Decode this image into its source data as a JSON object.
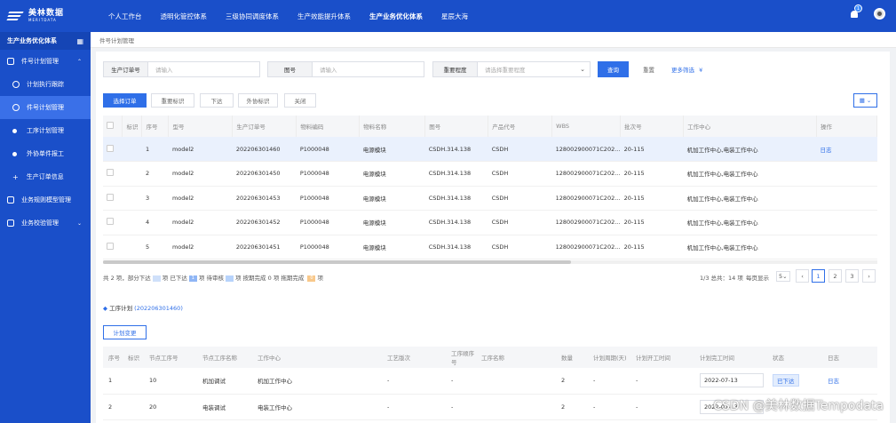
{
  "topbar": {
    "logo_cn": "美林数据",
    "logo_en": "MERITDATA",
    "nav": [
      "个人工作台",
      "透明化管控体系",
      "三级协同调度体系",
      "生产效能提升体系",
      "生产业务优化体系",
      "星辰大海"
    ],
    "badge": "1"
  },
  "sidebar": {
    "header": "生产业务优化体系",
    "items": [
      {
        "label": "件号计划管理"
      },
      {
        "label": "计划执行跟踪"
      },
      {
        "label": "件号计划管理"
      },
      {
        "label": "工序计划管理"
      },
      {
        "label": "外协单件报工"
      },
      {
        "label": "生产订单信息"
      },
      {
        "label": "业务规则模型管理"
      },
      {
        "label": "业务校验管理"
      }
    ]
  },
  "breadcrumb": "件号计划管理",
  "search": {
    "order_label": "生产订单号",
    "order_placeholder": "请输入",
    "drawing_label": "图号",
    "drawing_placeholder": "请输入",
    "priority_label": "重要程度",
    "priority_placeholder": "请选择重要程度",
    "query": "查询",
    "reset": "重置",
    "more": "更多筛选"
  },
  "toolbar": {
    "select_order": "选择订单",
    "important_mark": "重要标识",
    "issue": "下达",
    "outsource_mark": "外协标识",
    "close": "关闭"
  },
  "table": {
    "headers": [
      "标识",
      "序号",
      "型号",
      "生产订单号",
      "物料编码",
      "物料名称",
      "图号",
      "产品代号",
      "WBS",
      "批次号",
      "工作中心",
      "操作"
    ],
    "rows": [
      [
        "1",
        "model2",
        "202206301460",
        "P1000048",
        "电源模块",
        "CSDH.314.138",
        "CSDH",
        "128002900071C202...",
        "20-115",
        "机加工作中心,电装工作中心",
        "日志"
      ],
      [
        "2",
        "model2",
        "202206301450",
        "P1000048",
        "电源模块",
        "CSDH.314.138",
        "CSDH",
        "128002900071C202...",
        "20-115",
        "机加工作中心,电装工作中心",
        ""
      ],
      [
        "3",
        "model2",
        "202206301453",
        "P1000048",
        "电源模块",
        "CSDH.314.138",
        "CSDH",
        "128002900071C202...",
        "20-115",
        "机加工作中心,电装工作中心",
        ""
      ],
      [
        "4",
        "model2",
        "202206301452",
        "P1000048",
        "电源模块",
        "CSDH.314.138",
        "CSDH",
        "128002900071C202...",
        "20-115",
        "机加工作中心,电装工作中心",
        ""
      ],
      [
        "5",
        "model2",
        "202206301451",
        "P1000048",
        "电源模块",
        "CSDH.314.138",
        "CSDH",
        "128002900071C202...",
        "20-115",
        "机加工作中心,电装工作中心",
        ""
      ]
    ]
  },
  "summary": {
    "p1": "共",
    "total": "2",
    "p2": "项，部分下达",
    "p3": "项 已下达",
    "issued": "1",
    "p4": "项 待审核",
    "p5": "项 按期完成",
    "ontime": "0",
    "p6": "项 拖期完成",
    "late": "0",
    "p7": "项"
  },
  "pager": {
    "info": "1/3 总共：14 项",
    "per_page_label": "每页显示",
    "per_page": "5",
    "pages": [
      "1",
      "2",
      "3"
    ],
    "prev": "‹",
    "next": "›"
  },
  "colors": {
    "primary": "#2f6fe8",
    "topbar": "#1a4fc9",
    "chip_partial": "#cfe0fa",
    "chip_issued": "#8fb6f5",
    "chip_pending": "#b7d3fb",
    "chip_late": "#f8c88a"
  },
  "process": {
    "title": "工序计划",
    "order": "(202206301460)",
    "change_btn": "计划变更",
    "headers": [
      "序号",
      "标识",
      "节点工序号",
      "节点工序名称",
      "工作中心",
      "工艺版次",
      "工序顺序号",
      "工序名称",
      "数量",
      "计划周期(天)",
      "计划开工时间",
      "计划完工时间",
      "状态",
      "日志"
    ],
    "rows": [
      [
        "1",
        "",
        "10",
        "机加调试",
        "机加工作中心",
        "-",
        "-",
        "",
        "2",
        "-",
        "-",
        "2022-07-13",
        "已下达",
        "日志"
      ],
      [
        "2",
        "",
        "20",
        "电装调试",
        "电装工作中心",
        "-",
        "-",
        "",
        "2",
        "-",
        "-",
        "2022-07-13",
        "",
        ""
      ]
    ]
  },
  "watermark": "CSDN @美林数据Tempodata"
}
